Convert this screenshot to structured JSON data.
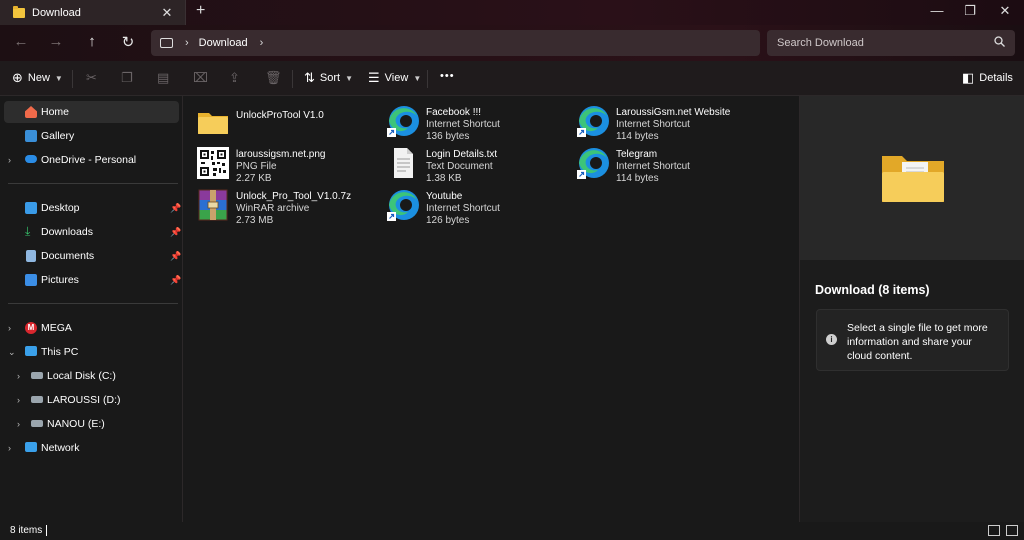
{
  "window": {
    "tab_title": "Download",
    "tab_close": "✕",
    "new_tab": "+",
    "minimize": "—",
    "maximize": "❐",
    "close": "✕"
  },
  "nav": {
    "back": "←",
    "forward": "→",
    "up": "↑",
    "refresh": "↻",
    "breadcrumb": "Download",
    "search_placeholder": "Search Download"
  },
  "commands": {
    "new_label": "New",
    "sort_label": "Sort",
    "view_label": "View",
    "more_label": "•••",
    "details_label": "Details"
  },
  "sidebar": {
    "items": [
      {
        "label": "Home",
        "icon": "home-icon"
      },
      {
        "label": "Gallery",
        "icon": "gallery-icon"
      },
      {
        "label": "OneDrive - Personal",
        "icon": "cloud-icon"
      },
      {
        "label": "Desktop",
        "icon": "desktop-icon"
      },
      {
        "label": "Downloads",
        "icon": "download-icon"
      },
      {
        "label": "Documents",
        "icon": "document-icon"
      },
      {
        "label": "Pictures",
        "icon": "pictures-icon"
      },
      {
        "label": "MEGA",
        "icon": "mega-icon"
      },
      {
        "label": "This PC",
        "icon": "pc-icon"
      },
      {
        "label": "Local Disk (C:)",
        "icon": "drive-icon"
      },
      {
        "label": "LAROUSSI (D:)",
        "icon": "drive-icon"
      },
      {
        "label": "NANOU (E:)",
        "icon": "drive-icon"
      },
      {
        "label": "Network",
        "icon": "network-icon"
      }
    ]
  },
  "files": [
    {
      "name": "UnlockProTool V1.0",
      "type": "",
      "size": "",
      "icon": "folder-icon"
    },
    {
      "name": "laroussigsm.net.png",
      "type": "PNG File",
      "size": "2.27 KB",
      "icon": "qr-image-icon"
    },
    {
      "name": "Unlock_Pro_Tool_V1.0.7z",
      "type": "WinRAR archive",
      "size": "2.73 MB",
      "icon": "winrar-icon"
    },
    {
      "name": "Facebook !!!",
      "type": "Internet Shortcut",
      "size": "136 bytes",
      "icon": "edge-icon"
    },
    {
      "name": "Login Details.txt",
      "type": "Text Document",
      "size": "1.38 KB",
      "icon": "text-file-icon"
    },
    {
      "name": "Youtube",
      "type": "Internet Shortcut",
      "size": "126 bytes",
      "icon": "edge-icon"
    },
    {
      "name": "LaroussiGsm.net Website",
      "type": "Internet Shortcut",
      "size": "114 bytes",
      "icon": "edge-icon"
    },
    {
      "name": "Telegram",
      "type": "Internet Shortcut",
      "size": "114 bytes",
      "icon": "edge-icon"
    }
  ],
  "details": {
    "title": "Download (8 items)",
    "info_text": "Select a single file to get more information and share your cloud content."
  },
  "status": {
    "count": "8 items"
  },
  "colors": {
    "folder": "#f2c43d",
    "edge_blue": "#1b8fe0",
    "edge_green": "#3cc47a"
  }
}
